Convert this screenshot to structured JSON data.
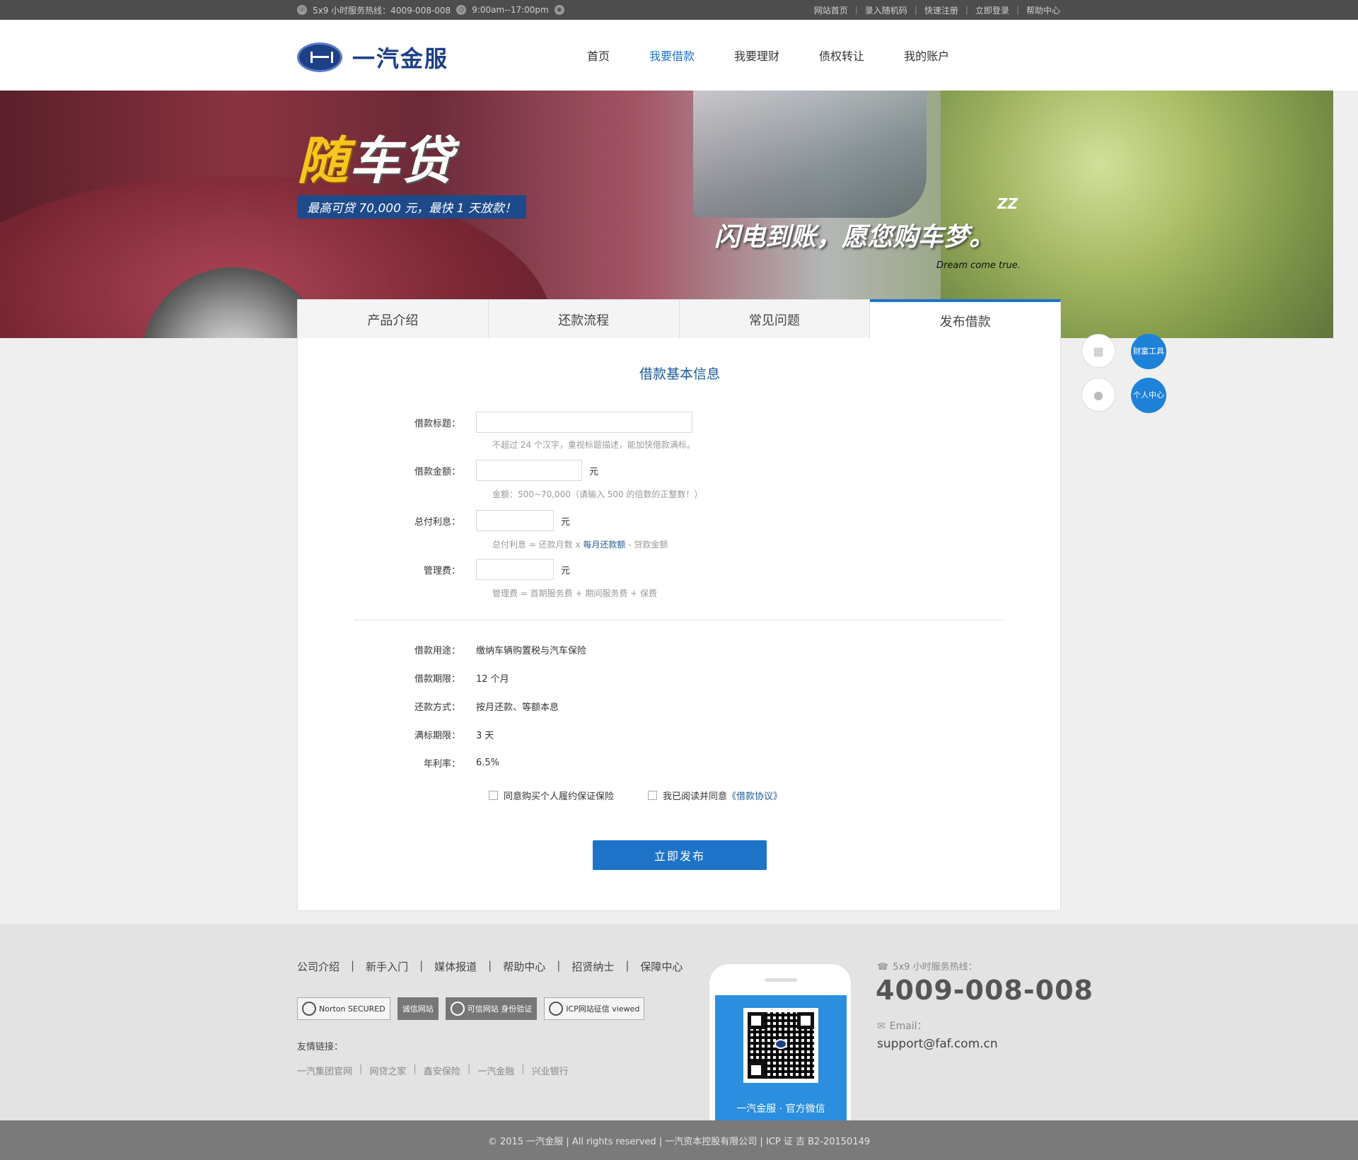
{
  "topbar": {
    "hotline": "5x9 小时服务热线：4009-008-008",
    "hours": "9:00am--17:00pm",
    "links": [
      "网站首页",
      "录入随机码",
      "快速注册",
      "立即登录",
      "帮助中心"
    ]
  },
  "header": {
    "logo_text": "一汽金服",
    "nav": [
      "首页",
      "我要借款",
      "我要理财",
      "债权转让",
      "我的账户"
    ],
    "active_nav": "我要借款"
  },
  "banner": {
    "title_a": "随",
    "title_b": "车贷",
    "subtitle": "最高可贷 70,000 元，最快 1 天放款！",
    "slogan": "闪电到账，愿您购车梦。",
    "slogan_en": "Dream come true.",
    "zz": "ZZ"
  },
  "tabs": [
    "产品介绍",
    "还款流程",
    "常见问题",
    "发布借款"
  ],
  "form": {
    "title": "借款基本信息",
    "loan_title_label": "借款标题：",
    "loan_title_hint": "不超过 24 个汉字，重视标题描述，能加快借款满标。",
    "amount_label": "借款金额：",
    "amount_unit": "元",
    "amount_hint": "金额：500~70,000（请输入 500 的倍数的正整数！）",
    "interest_label": "总付利息：",
    "interest_unit": "元",
    "interest_hint_a": "总付利息 = 还款月数 x ",
    "interest_hint_link": "每月还款额",
    "interest_hint_b": " - 贷款金额",
    "fee_label": "管理费：",
    "fee_unit": "元",
    "fee_hint": "管理费 = 首期服务费 + 期间服务费 + 保费"
  },
  "info": [
    {
      "label": "借款用途：",
      "value": "缴纳车辆购置税与汽车保险"
    },
    {
      "label": "借款期限：",
      "value": "12 个月"
    },
    {
      "label": "还款方式：",
      "value": "按月还款、等额本息"
    },
    {
      "label": "满标期限：",
      "value": "3 天"
    },
    {
      "label": "年利率：",
      "value": "6.5%"
    }
  ],
  "checks": {
    "insurance": "同意购买个人履约保证保险",
    "agree": "我已阅读并同意",
    "agreement_link": "《借款协议》"
  },
  "submit_label": "立即发布",
  "side": {
    "wealth_tools": "财富工具",
    "personal_center": "个人中心"
  },
  "footer": {
    "links": [
      "公司介绍",
      "新手入门",
      "媒体报道",
      "帮助中心",
      "招贤纳士",
      "保障中心"
    ],
    "badges": [
      "Norton SECURED",
      "诚信网站",
      "可信网站 身份验证",
      "ICP网站征信 viewed"
    ],
    "friends_title": "友情链接：",
    "friends": [
      "一汽集团官网",
      "网贷之家",
      "鑫安保险",
      "一汽金融",
      "兴业银行"
    ],
    "wechat_caption": "一汽金服 · 官方微信",
    "hotline_label": "5x9 小时服务热线：",
    "hotline": "4009-008-008",
    "email_label": "Email：",
    "email": "support@faf.com.cn"
  },
  "copyright": "© 2015 一汽金服 | All rights reserved | 一汽资本控股有限公司 | ICP 证 吉 B2-20150149"
}
